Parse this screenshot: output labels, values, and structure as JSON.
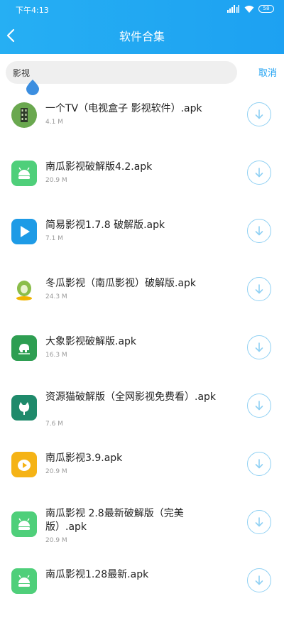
{
  "status_bar": {
    "time": "下午4:13",
    "battery": "58"
  },
  "header": {
    "title": "软件合集"
  },
  "search": {
    "value": "影视",
    "cancel_label": "取消"
  },
  "colors": {
    "accent": "#1da1f2",
    "download_ring": "#8fd0f3"
  },
  "apps": [
    {
      "name": "一个TV（电视盒子 影视软件）.apk",
      "size": "4.1 M",
      "icon": "film-strip-icon",
      "color": "#6aa84f"
    },
    {
      "name": "南瓜影视破解版4.2.apk",
      "size": "20.9 M",
      "icon": "android-icon",
      "color": "#4fcf7a"
    },
    {
      "name": "简易影视1.7.8 破解版.apk",
      "size": "7.1 M",
      "icon": "play-icon",
      "color": "#1e9be6"
    },
    {
      "name": "冬瓜影视（南瓜影视）破解版.apk",
      "size": "24.3 M",
      "icon": "melon-icon",
      "color": "#8bbd4a"
    },
    {
      "name": "大象影视破解版.apk",
      "size": "16.3 M",
      "icon": "elephant-icon",
      "color": "#2e9e52"
    },
    {
      "name": "资源猫破解版（全网影视免费看）.apk",
      "size": "7.6 M",
      "icon": "cat-icon",
      "color": "#1f8a6b"
    },
    {
      "name": "南瓜影视3.9.apk",
      "size": "20.9 M",
      "icon": "pumpkin-play-icon",
      "color": "#f5b316"
    },
    {
      "name": "南瓜影视 2.8最新破解版（完美版）.apk",
      "size": "20.9 M",
      "icon": "android-icon",
      "color": "#4fcf7a"
    },
    {
      "name": "南瓜影视1.28最新.apk",
      "size": "",
      "icon": "android-icon",
      "color": "#4fcf7a"
    }
  ]
}
